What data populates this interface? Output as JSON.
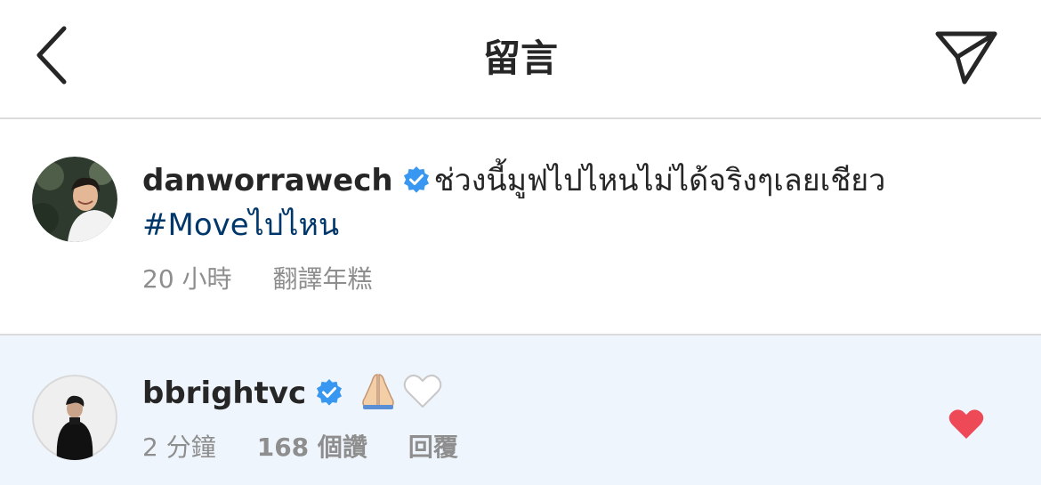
{
  "header": {
    "title": "留言",
    "back_icon": "chevron-left-icon",
    "share_icon": "paper-plane-icon"
  },
  "caption": {
    "username": "danworrawech",
    "verified": true,
    "text": "ช่วงนี้มูฟไปไหนไม่ได้จริงๆเลยเชียว",
    "hashtag": "#Moveไปไหน",
    "time": "20 小時",
    "translate": "翻譯年糕"
  },
  "comment": {
    "username": "bbrightvc",
    "verified": true,
    "emojis": [
      "folded-hands-emoji",
      "white-heart-emoji"
    ],
    "time": "2 分鐘",
    "likes": "168 個讚",
    "reply": "回覆",
    "liked": true,
    "like_color": "#ed4956"
  },
  "colors": {
    "verified_blue": "#3897f0",
    "hashtag_blue": "#00376b",
    "highlight_bg": "#eff5fc",
    "meta_gray": "#8e8e8e"
  }
}
